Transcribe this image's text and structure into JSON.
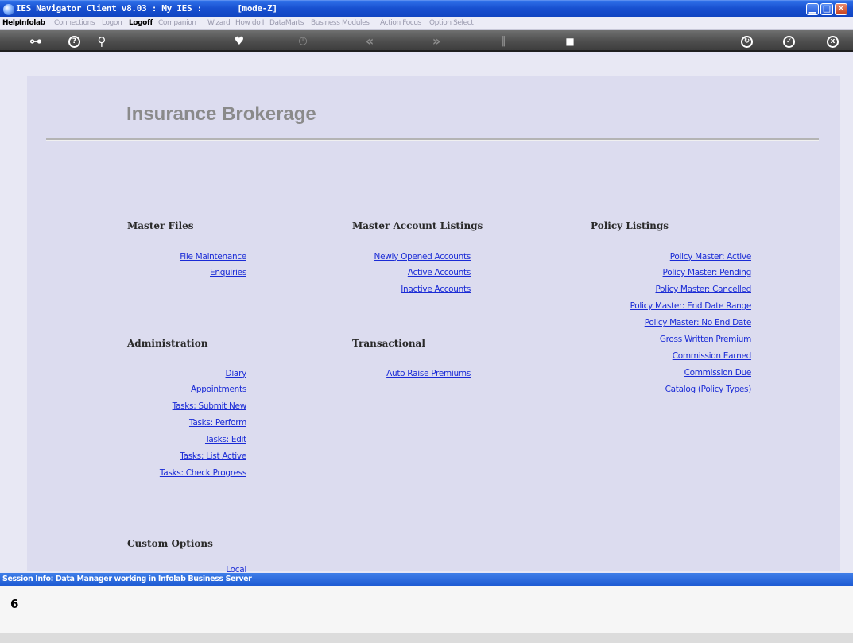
{
  "window": {
    "title": "IES Navigator Client v8.03 : My IES :       [mode-Z]",
    "min_glyph": "▁",
    "max_glyph": "□",
    "close_glyph": "✕"
  },
  "menu": [
    {
      "label": "Help",
      "active": true
    },
    {
      "label": "Infolab",
      "active": true
    },
    {
      "label": "Connections",
      "active": false
    },
    {
      "label": "Logon",
      "active": false
    },
    {
      "label": "Logoff",
      "active": true
    },
    {
      "label": "Companion",
      "active": false
    },
    {
      "label": "Wizard",
      "active": false
    },
    {
      "label": "How do I",
      "active": false
    },
    {
      "label": "DataMarts",
      "active": false
    },
    {
      "label": "Business Modules",
      "active": false
    },
    {
      "label": "Action Focus",
      "active": false
    },
    {
      "label": "Option Select",
      "active": false
    }
  ],
  "toolbar": {
    "key": "⊶",
    "help": "?",
    "search": "⚲",
    "favourite": "♥",
    "clock": "◷",
    "rewind": "«",
    "forward": "»",
    "pause": "‖",
    "stop": "■",
    "refresh": "↻",
    "ok": "✓",
    "exit": "x"
  },
  "page": {
    "title": "Insurance Brokerage"
  },
  "sections": {
    "master_files": {
      "heading": "Master Files",
      "links": [
        "File Maintenance",
        "Enquiries"
      ]
    },
    "administration": {
      "heading": "Administration",
      "links": [
        "Diary",
        "Appointments",
        "Tasks: Submit New",
        "Tasks: Perform",
        "Tasks: Edit",
        "Tasks: List Active",
        "Tasks: Check Progress"
      ]
    },
    "custom_options": {
      "heading": "Custom Options",
      "links": [
        "Local"
      ]
    },
    "master_account_listings": {
      "heading": "Master Account Listings",
      "links": [
        "Newly Opened Accounts",
        "Active Accounts",
        "Inactive Accounts"
      ]
    },
    "transactional": {
      "heading": "Transactional",
      "links": [
        "Auto Raise Premiums"
      ]
    },
    "policy_listings": {
      "heading": "Policy Listings",
      "links": [
        "Policy Master: Active",
        "Policy Master: Pending",
        "Policy Master: Cancelled",
        "Policy Master: End Date Range",
        "Policy Master: No End Date",
        "Gross Written Premium",
        "Commission Earned",
        "Commission Due",
        "Catalog (Policy Types)"
      ]
    }
  },
  "session": {
    "info": "Session Info: Data Manager working in Infolab Business Server",
    "cursor_glyph": "6"
  }
}
